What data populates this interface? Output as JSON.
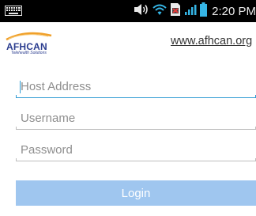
{
  "status_bar": {
    "time": "2:20 PM",
    "icons": [
      "keyboard-icon",
      "volume-icon",
      "wifi-icon",
      "sim-card-icon",
      "signal-icon",
      "battery-icon"
    ]
  },
  "header": {
    "logo_text": "AFHCAN",
    "logo_tagline": "Telehealth Solutions",
    "website": "www.afhcan.org"
  },
  "form": {
    "host_placeholder": "Host Address",
    "username_placeholder": "Username",
    "password_placeholder": "Password",
    "login_label": "Login"
  },
  "colors": {
    "focus_underline": "#2e9bd3",
    "button_bg": "#9fc6ef",
    "logo_blue": "#2b3d8f",
    "logo_orange": "#f0a02a"
  }
}
